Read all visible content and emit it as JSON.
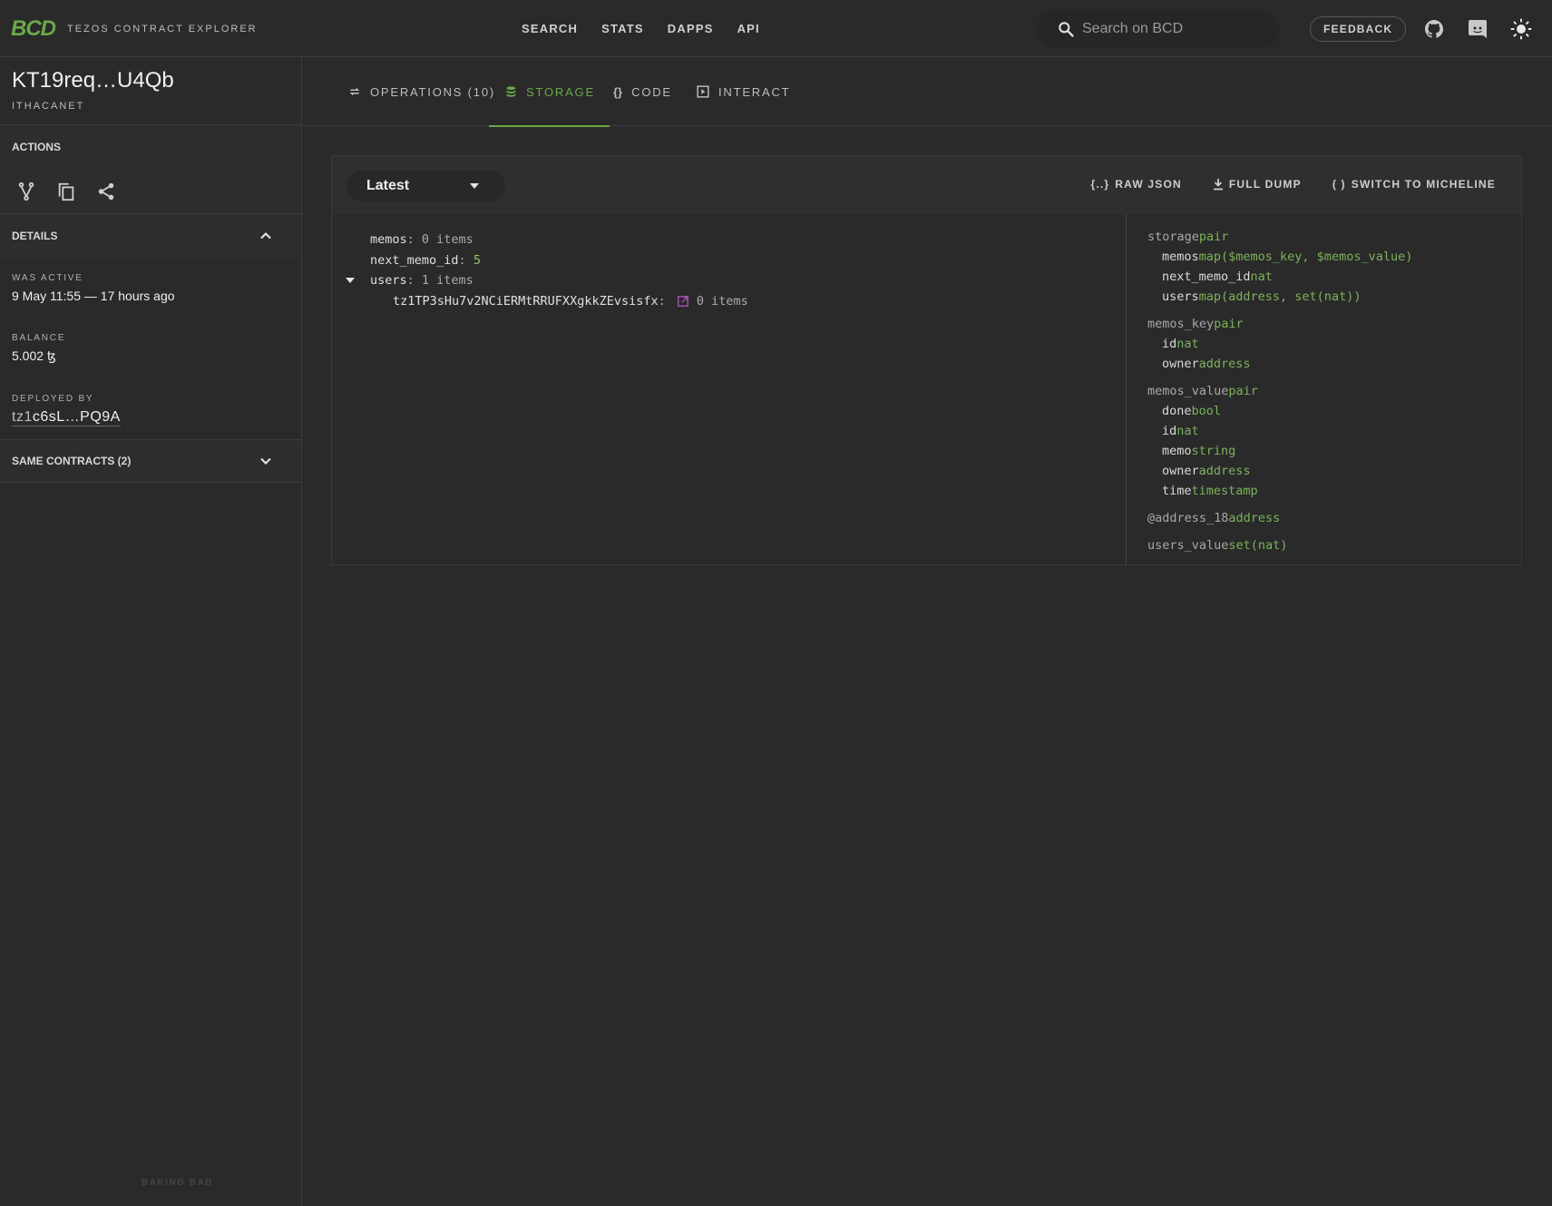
{
  "header": {
    "logo": "BCD",
    "logo_subtitle": "TEZOS CONTRACT EXPLORER",
    "nav": [
      "SEARCH",
      "STATS",
      "DAPPS",
      "API"
    ],
    "search_placeholder": "Search on BCD",
    "feedback_label": "FEEDBACK",
    "icons": [
      "github-icon",
      "discord-icon",
      "theme-toggle-icon"
    ]
  },
  "contract": {
    "name": "KT19req…U4Qb",
    "network": "ITHACANET"
  },
  "sidebar": {
    "actions_title": "ACTIONS",
    "actions": [
      "fork-icon",
      "copy-icon",
      "share-icon"
    ],
    "details_title": "DETAILS",
    "was_active_label": "WAS ACTIVE",
    "was_active_value": "9 May 11:55 — 17 hours ago",
    "balance_label": "BALANCE",
    "balance_value": "5.002 ꜩ",
    "deployed_by_label": "DEPLOYED BY",
    "deployed_by_prefix": "tz1",
    "deployed_by_rest": "c6sL…PQ9A",
    "same_contracts_label": "SAME CONTRACTS (2)",
    "footer": "BAKING BAD"
  },
  "tabs": [
    {
      "label": "OPERATIONS (10)",
      "icon": "swap-arrows-icon",
      "active": false
    },
    {
      "label": "STORAGE",
      "icon": "database-icon",
      "active": true
    },
    {
      "label": "CODE",
      "icon": "braces-icon",
      "active": false
    },
    {
      "label": "INTERACT",
      "icon": "play-box-icon",
      "active": false
    }
  ],
  "storage": {
    "version_selected": "Latest",
    "toolbar": {
      "raw_json": "RAW JSON",
      "full_dump": "FULL DUMP",
      "switch_micheline": "SWITCH TO MICHELINE"
    },
    "tree": [
      {
        "key": "memos",
        "value": "0 items",
        "value_kind": "count",
        "expandable": false
      },
      {
        "key": "next_memo_id",
        "value": "5",
        "value_kind": "number",
        "expandable": false
      },
      {
        "key": "users",
        "value": "1 items",
        "value_kind": "count",
        "expandable": true,
        "expanded": true
      },
      {
        "key": "tz1TP3sHu7v2NCiERMtRRUFXXgkkZEvsisfx",
        "value": "0 items",
        "value_kind": "count",
        "child": true,
        "link": true
      }
    ],
    "schema": [
      {
        "name": "storage",
        "type": "pair",
        "fields": [
          {
            "name": "memos",
            "type": "map($memos_key, $memos_value)"
          },
          {
            "name": "next_memo_id",
            "type": "nat"
          },
          {
            "name": "users",
            "type": "map(address, set(nat))"
          }
        ]
      },
      {
        "name": "memos_key",
        "type": "pair",
        "fields": [
          {
            "name": "id",
            "type": "nat"
          },
          {
            "name": "owner",
            "type": "address"
          }
        ]
      },
      {
        "name": "memos_value",
        "type": "pair",
        "fields": [
          {
            "name": "done",
            "type": "bool"
          },
          {
            "name": "id",
            "type": "nat"
          },
          {
            "name": "memo",
            "type": "string"
          },
          {
            "name": "owner",
            "type": "address"
          },
          {
            "name": "time",
            "type": "timestamp"
          }
        ]
      },
      {
        "name": "@address_18",
        "type": "address",
        "fields": []
      },
      {
        "name": "users_value",
        "type": "set(nat)",
        "fields": []
      }
    ]
  },
  "colors": {
    "accent": "#6aa94a",
    "background": "#2a2a2a",
    "link_icon": "#a04fb0"
  }
}
